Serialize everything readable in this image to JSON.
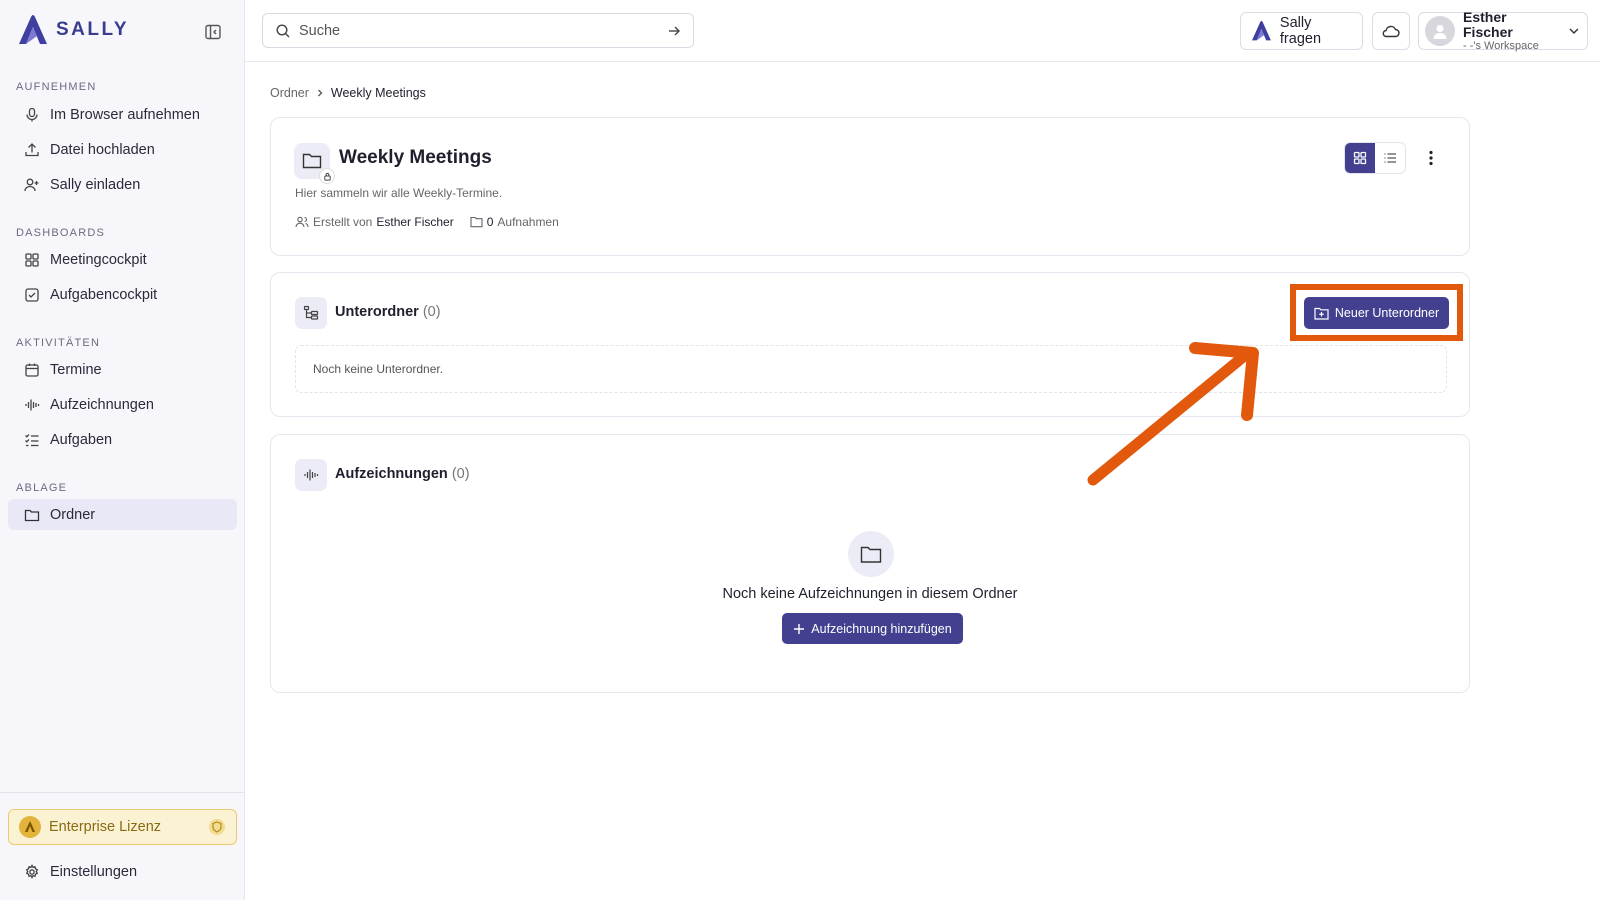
{
  "brand": {
    "name": "SALLY"
  },
  "sidebar": {
    "sections": [
      {
        "label": "AUFNEHMEN"
      },
      {
        "label": "DASHBOARDS"
      },
      {
        "label": "AKTIVITÄTEN"
      },
      {
        "label": "ABLAGE"
      }
    ],
    "items": [
      {
        "label": "Im Browser aufnehmen",
        "icon": "microphone-icon"
      },
      {
        "label": "Datei hochladen",
        "icon": "upload-icon"
      },
      {
        "label": "Sally einladen",
        "icon": "user-plus-icon"
      },
      {
        "label": "Meetingcockpit",
        "icon": "grid-icon"
      },
      {
        "label": "Aufgabencockpit",
        "icon": "check-square-icon"
      },
      {
        "label": "Termine",
        "icon": "calendar-icon"
      },
      {
        "label": "Aufzeichnungen",
        "icon": "waveform-icon"
      },
      {
        "label": "Aufgaben",
        "icon": "checklist-icon"
      },
      {
        "label": "Ordner",
        "icon": "folder-icon",
        "active": true
      }
    ],
    "license": "Enterprise Lizenz",
    "settings": "Einstellungen"
  },
  "topbar": {
    "search_placeholder": "Suche",
    "ask_label": "Sally fragen",
    "user": {
      "name": "Esther Fischer",
      "workspace": "- -'s Workspace"
    }
  },
  "breadcrumb": {
    "root": "Ordner",
    "current": "Weekly Meetings"
  },
  "folder": {
    "title": "Weekly Meetings",
    "description": "Hier sammeln wir alle Weekly-Termine.",
    "created_by_label": "Erstellt von",
    "creator": "Esther Fischer",
    "recordings_count": "0",
    "recordings_label": "Aufnahmen"
  },
  "subfolders": {
    "title": "Unterordner",
    "count": "(0)",
    "new_button": "Neuer Unterordner",
    "empty_text": "Noch keine Unterordner."
  },
  "recordings": {
    "title": "Aufzeichnungen",
    "count": "(0)",
    "empty_text": "Noch keine Aufzeichnungen in diesem Ordner",
    "add_button": "Aufzeichnung hinzufügen"
  },
  "colors": {
    "accent": "#42408f",
    "annotation": "#e2580d",
    "license_bg": "#fbf2d3"
  }
}
